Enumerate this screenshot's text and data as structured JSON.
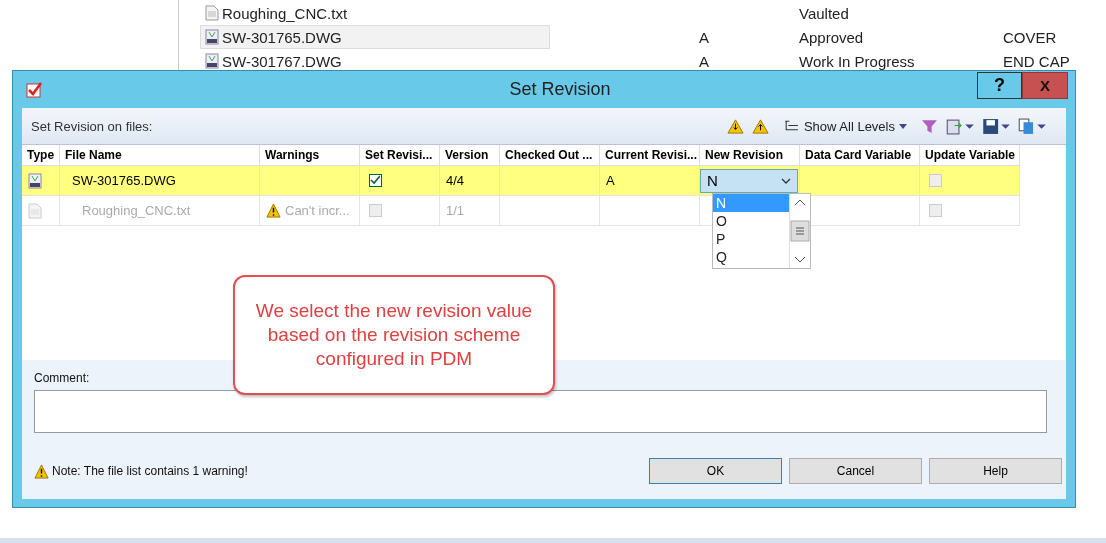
{
  "background_files": [
    {
      "name": "Roughing_CNC.txt",
      "kind": "txt",
      "state": "Vaulted",
      "selected": false
    },
    {
      "name": "SW-301765.DWG",
      "kind": "dwg",
      "revision": "A",
      "state": "Approved",
      "description": "COVER",
      "selected": true
    },
    {
      "name": "SW-301767.DWG",
      "kind": "dwg",
      "revision": "A",
      "state": "Work In Progress",
      "description": "END CAP",
      "selected": false
    }
  ],
  "dialog": {
    "title": "Set Revision",
    "help_button": "?",
    "close_button": "X",
    "toolbar": {
      "label": "Set Revision on files:",
      "show_levels": "Show All Levels"
    },
    "columns": [
      "Type",
      "File Name",
      "Warnings",
      "Set Revisi...",
      "Version",
      "Checked Out ...",
      "Current Revisi...",
      "New Revision",
      "Data Card Variable",
      "Update Variable"
    ],
    "rows": [
      {
        "kind": "dwg",
        "file_name": "SW-301765.DWG",
        "set_revision": true,
        "version": "4/4",
        "current_revision": "A",
        "new_revision": "N",
        "update_variable": false,
        "disabled": false,
        "selected": true
      },
      {
        "kind": "txt",
        "file_name": "Roughing_CNC.txt",
        "warning": "Can't incr...",
        "set_revision": false,
        "version": "1/1",
        "update_variable": false,
        "disabled": true,
        "selected": false
      }
    ],
    "dropdown_options": [
      {
        "label": "N",
        "selected": true
      },
      {
        "label": "O",
        "selected": false
      },
      {
        "label": "P",
        "selected": false
      },
      {
        "label": "Q",
        "selected": false
      }
    ],
    "callout": "We select the new revision value based on the revision scheme configured in PDM",
    "comment_label": "Comment:",
    "note": "Note: The file list contains 1 warning!",
    "buttons": [
      "OK",
      "Cancel",
      "Help"
    ]
  }
}
